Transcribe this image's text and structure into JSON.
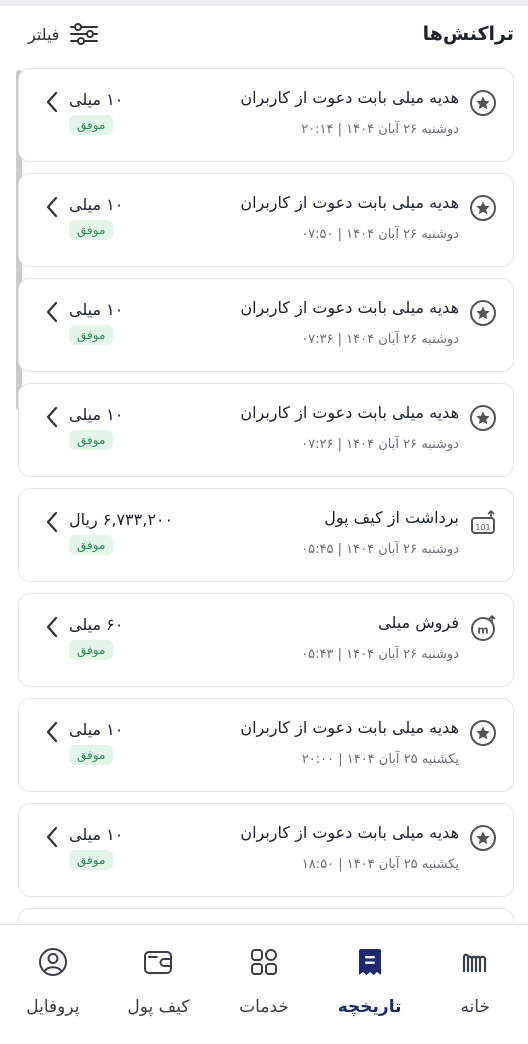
{
  "header": {
    "title": "تراکنش‌ها",
    "filter_label": "فیلتر"
  },
  "transactions": [
    {
      "icon": "star-icon",
      "description": "هدیه میلی بابت دعوت از کاربران",
      "date": "دوشنبه ۲۶ آبان ۱۴۰۴ | ۲۰:۱۴",
      "amount": "۱۰ میلی",
      "status": "موفق"
    },
    {
      "icon": "star-icon",
      "description": "هدیه میلی بابت دعوت از کاربران",
      "date": "دوشنبه ۲۶ آبان ۱۴۰۴ | ۰۷:۵۰",
      "amount": "۱۰ میلی",
      "status": "موفق"
    },
    {
      "icon": "star-icon",
      "description": "هدیه میلی بابت دعوت از کاربران",
      "date": "دوشنبه ۲۶ آبان ۱۴۰۴ | ۰۷:۳۶",
      "amount": "۱۰ میلی",
      "status": "موفق"
    },
    {
      "icon": "star-icon",
      "description": "هدیه میلی بابت دعوت از کاربران",
      "date": "دوشنبه ۲۶ آبان ۱۴۰۴ | ۰۷:۲۶",
      "amount": "۱۰ میلی",
      "status": "موفق"
    },
    {
      "icon": "withdraw-icon",
      "description": "برداشت از کیف پول",
      "date": "دوشنبه ۲۶ آبان ۱۴۰۴ | ۰۵:۴۵",
      "amount": "۶,۷۳۳,۲۰۰ ریال",
      "status": "موفق"
    },
    {
      "icon": "milli-sell-icon",
      "description": "فروش میلی",
      "date": "دوشنبه ۲۶ آبان ۱۴۰۴ | ۰۵:۴۳",
      "amount": "۶۰ میلی",
      "status": "موفق"
    },
    {
      "icon": "star-icon",
      "description": "هدیه میلی بابت دعوت از کاربران",
      "date": "یکشنبه ۲۵ آبان ۱۴۰۴ | ۲۰:۰۰",
      "amount": "۱۰ میلی",
      "status": "موفق"
    },
    {
      "icon": "star-icon",
      "description": "هدیه میلی بابت دعوت از کاربران",
      "date": "یکشنبه ۲۵ آبان ۱۴۰۴ | ۱۸:۵۰",
      "amount": "۱۰ میلی",
      "status": "موفق"
    }
  ],
  "tabbar": {
    "active": "history",
    "items": [
      {
        "id": "home",
        "label": "خانه",
        "icon": "milli-logo-icon"
      },
      {
        "id": "history",
        "label": "تاریخچه",
        "icon": "receipt-icon"
      },
      {
        "id": "services",
        "label": "خدمات",
        "icon": "grid-icon"
      },
      {
        "id": "wallet",
        "label": "کیف پول",
        "icon": "wallet-icon"
      },
      {
        "id": "profile",
        "label": "پروفایل",
        "icon": "user-icon"
      }
    ]
  },
  "colors": {
    "accent": "#1e2a6e",
    "success_bg": "#e4f5ea",
    "success_text": "#2f8f52"
  }
}
